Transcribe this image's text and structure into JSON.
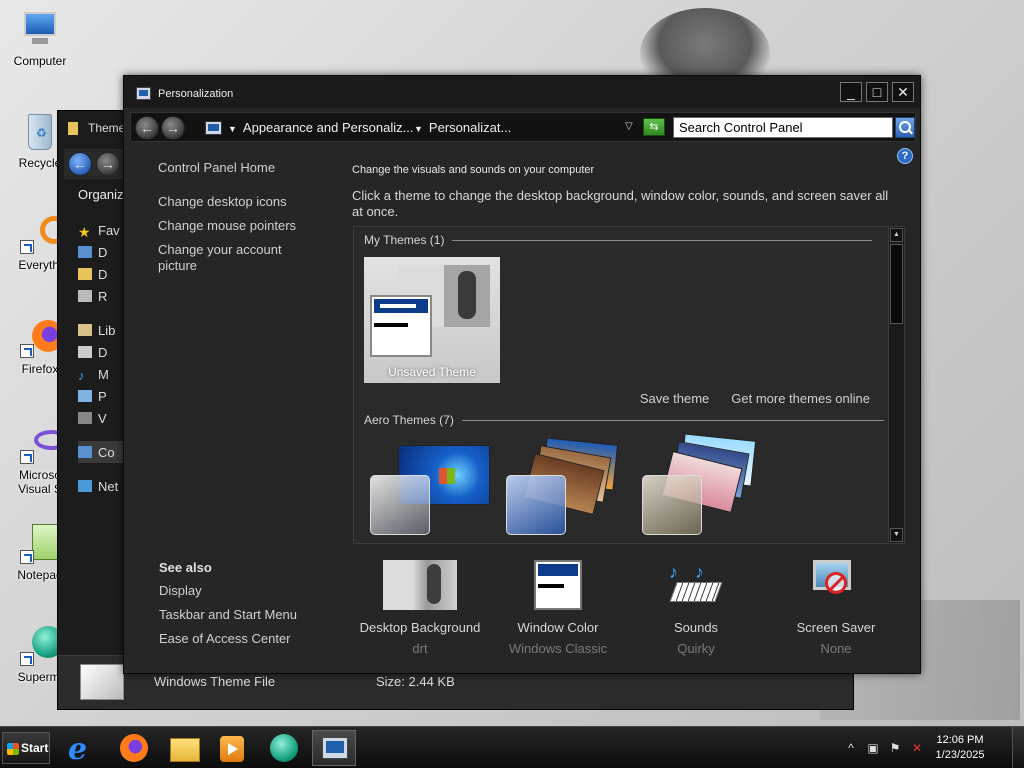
{
  "desktop": {
    "icons": [
      {
        "label": "Computer",
        "icon": "computer-icon"
      },
      {
        "label": "Recycle",
        "icon": "recycle-bin-icon"
      },
      {
        "label": "Everythi",
        "icon": "everything-search-icon"
      },
      {
        "label": "Firefox",
        "icon": "firefox-icon"
      },
      {
        "label": "Microso",
        "label2": "Visual S",
        "icon": "visual-studio-icon"
      },
      {
        "label": "Notepad",
        "icon": "notepad-icon"
      },
      {
        "label": "Supermi",
        "icon": "supermium-icon"
      }
    ]
  },
  "explorer": {
    "title": "Theme",
    "organize": "Organiz",
    "favorites": "Fav",
    "items": [
      "D",
      "D",
      "R"
    ],
    "libraries": "Lib",
    "lib_items": [
      "D",
      "M",
      "P",
      "V"
    ],
    "computer": "Co",
    "network": "Net",
    "file_type": "Windows Theme File",
    "file_size": "Size: 2.44 KB"
  },
  "window": {
    "title": "Personalization",
    "controls": {
      "minimize": "_",
      "maximize": "□",
      "close": "✕"
    },
    "breadcrumb": [
      "Appearance and Personaliz...",
      "Personalizat..."
    ],
    "search_value": "Search Control Panel",
    "help": "?"
  },
  "left_pane": {
    "home": "Control Panel Home",
    "links": [
      "Change desktop icons",
      "Change mouse pointers",
      "Change your account picture"
    ],
    "see_also_title": "See also",
    "see_also": [
      "Display",
      "Taskbar and Start Menu",
      "Ease of Access Center"
    ]
  },
  "main": {
    "header": "Change the visuals and sounds on your computer",
    "description": "Click a theme to change the desktop background, window color, sounds, and screen saver all at once.",
    "my_themes_header": "My Themes (1)",
    "unsaved_theme": "Unsaved Theme",
    "save_theme": "Save theme",
    "get_more": "Get more themes online",
    "aero_header": "Aero Themes (7)"
  },
  "bottom": {
    "background": {
      "label": "Desktop Background",
      "value": "drt"
    },
    "window_color": {
      "label": "Window Color",
      "value": "Windows Classic"
    },
    "sounds": {
      "label": "Sounds",
      "value": "Quirky"
    },
    "screen_saver": {
      "label": "Screen Saver",
      "value": "None"
    }
  },
  "taskbar": {
    "start": "Start",
    "apps": [
      "internet-explorer",
      "firefox",
      "file-explorer",
      "media-player",
      "supermium",
      "control-panel"
    ],
    "time": "12:06 PM",
    "date": "1/23/2025"
  }
}
